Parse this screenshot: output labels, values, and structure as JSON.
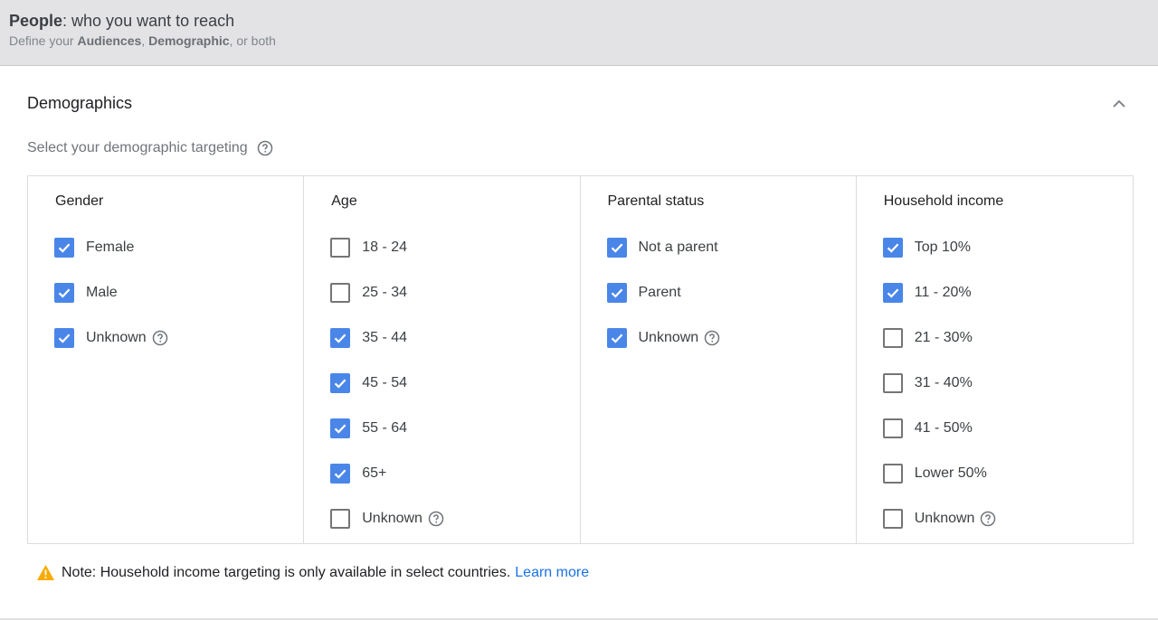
{
  "header": {
    "title_bold": "People",
    "title_rest": ": who you want to reach",
    "sub_prefix": "Define your ",
    "sub_audiences": "Audiences",
    "sub_comma": ", ",
    "sub_demographic": "Demographic",
    "sub_suffix": ", or both"
  },
  "section": {
    "title": "Demographics",
    "subtitle": "Select your demographic targeting"
  },
  "columns": [
    {
      "title": "Gender",
      "options": [
        {
          "label": "Female",
          "checked": true,
          "help": false
        },
        {
          "label": "Male",
          "checked": true,
          "help": false
        },
        {
          "label": "Unknown",
          "checked": true,
          "help": true
        }
      ]
    },
    {
      "title": "Age",
      "options": [
        {
          "label": "18 - 24",
          "checked": false,
          "help": false
        },
        {
          "label": "25 - 34",
          "checked": false,
          "help": false
        },
        {
          "label": "35 - 44",
          "checked": true,
          "help": false
        },
        {
          "label": "45 - 54",
          "checked": true,
          "help": false
        },
        {
          "label": "55 - 64",
          "checked": true,
          "help": false
        },
        {
          "label": "65+",
          "checked": true,
          "help": false
        },
        {
          "label": "Unknown",
          "checked": false,
          "help": true
        }
      ]
    },
    {
      "title": "Parental status",
      "options": [
        {
          "label": "Not a parent",
          "checked": true,
          "help": false
        },
        {
          "label": "Parent",
          "checked": true,
          "help": false
        },
        {
          "label": "Unknown",
          "checked": true,
          "help": true
        }
      ]
    },
    {
      "title": "Household income",
      "options": [
        {
          "label": "Top 10%",
          "checked": true,
          "help": false
        },
        {
          "label": "11 - 20%",
          "checked": true,
          "help": false
        },
        {
          "label": "21 - 30%",
          "checked": false,
          "help": false
        },
        {
          "label": "31 - 40%",
          "checked": false,
          "help": false
        },
        {
          "label": "41 - 50%",
          "checked": false,
          "help": false
        },
        {
          "label": "Lower 50%",
          "checked": false,
          "help": false
        },
        {
          "label": "Unknown",
          "checked": false,
          "help": true
        }
      ]
    }
  ],
  "note": {
    "text": "Note: Household income targeting is only available in select countries.",
    "link": "Learn more"
  },
  "icons": {
    "help": "help-circle-icon",
    "collapse": "chevron-up-icon",
    "warning": "warning-icon",
    "check": "checkmark-icon"
  },
  "colors": {
    "checkbox_checked": "#4a86e8",
    "link": "#1a73e8",
    "warning": "#f9ab00",
    "header_bg": "#e3e3e6"
  }
}
